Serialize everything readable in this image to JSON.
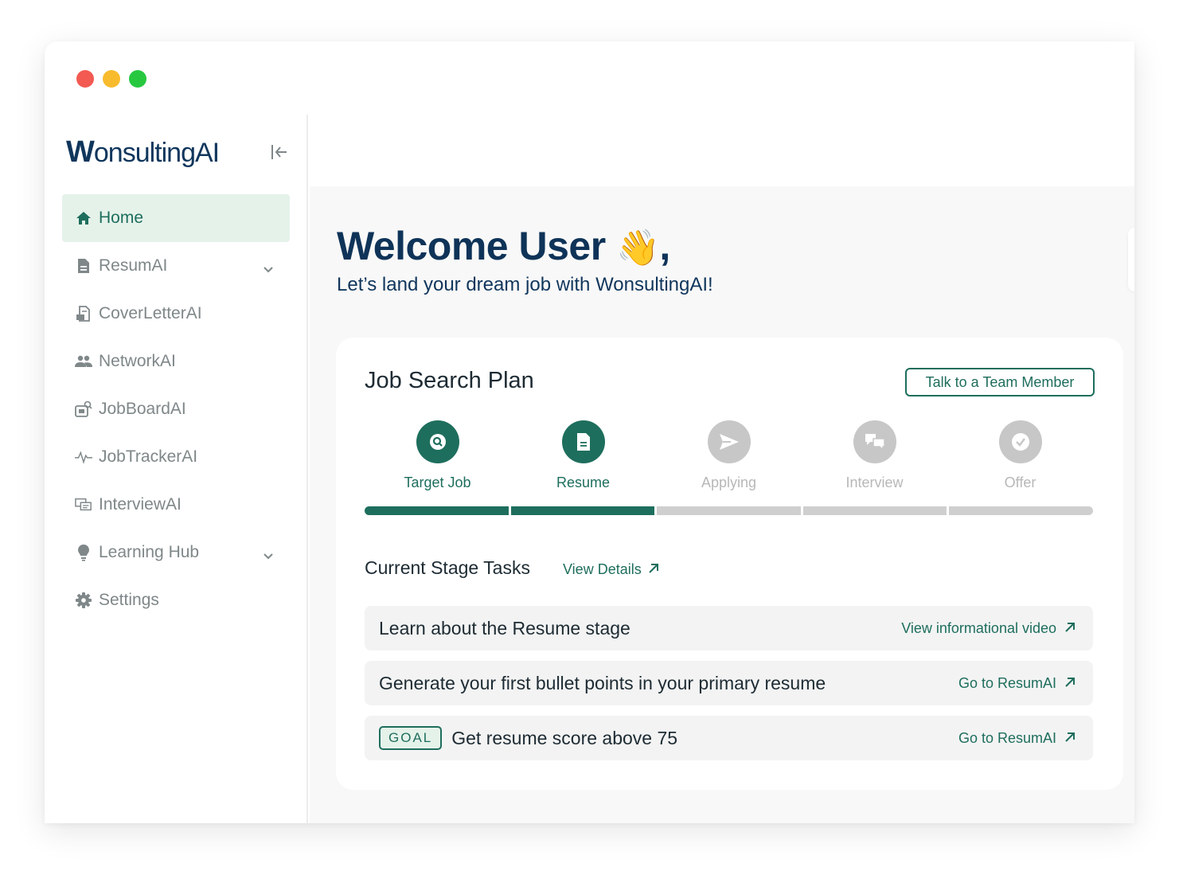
{
  "window": {
    "controls": [
      "close",
      "minimize",
      "maximize"
    ]
  },
  "sidebar": {
    "logo": {
      "first": "W",
      "rest": "onsultingAI"
    },
    "collapse_icon": "collapse-left-icon",
    "items": [
      {
        "label": "Home",
        "icon": "home-icon",
        "active": true
      },
      {
        "label": "ResumAI",
        "icon": "document-icon",
        "has_submenu": true
      },
      {
        "label": "CoverLetterAI",
        "icon": "cover-letter-icon"
      },
      {
        "label": "NetworkAI",
        "icon": "people-icon"
      },
      {
        "label": "JobBoardAI",
        "icon": "job-board-icon"
      },
      {
        "label": "JobTrackerAI",
        "icon": "pulse-icon"
      },
      {
        "label": "InterviewAI",
        "icon": "chat-icon"
      },
      {
        "label": "Learning Hub",
        "icon": "lightbulb-icon",
        "has_submenu": true
      },
      {
        "label": "Settings",
        "icon": "gear-icon"
      }
    ]
  },
  "main": {
    "welcome": "Welcome User",
    "wave": "👋",
    "comma": ",",
    "subtitle": "Let’s land your dream job with WonsultingAI!"
  },
  "plan": {
    "title": "Job Search Plan",
    "talk_button": "Talk to a Team Member",
    "steps": [
      {
        "label": "Target Job",
        "icon": "search-icon",
        "status": "complete"
      },
      {
        "label": "Resume",
        "icon": "document-icon",
        "status": "current"
      },
      {
        "label": "Applying",
        "icon": "send-icon",
        "status": "upcoming"
      },
      {
        "label": "Interview",
        "icon": "chat-icon",
        "status": "upcoming"
      },
      {
        "label": "Offer",
        "icon": "badge-check-icon",
        "status": "upcoming"
      }
    ],
    "progress": {
      "completed_segments": 2,
      "total_segments": 5
    },
    "current_stage_title": "Current Stage Tasks",
    "view_details": "View Details",
    "tasks": [
      {
        "text": "Learn about the Resume stage",
        "link": "View informational video",
        "goal": false
      },
      {
        "text": "Generate your first bullet points in your primary resume",
        "link": "Go to ResumAI",
        "goal": false
      },
      {
        "text": "Get resume score above 75",
        "link": "Go to ResumAI",
        "goal": true,
        "goal_label": "GOAL"
      }
    ]
  },
  "colors": {
    "accent": "#1e6e5d",
    "accent_light": "#e5f2ea",
    "heading": "#0f3358",
    "inactive": "#c7c7c7"
  }
}
